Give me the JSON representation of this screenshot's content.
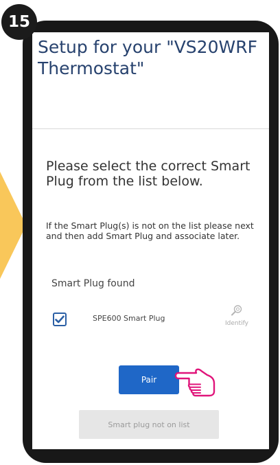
{
  "step": {
    "number": "15"
  },
  "screen": {
    "title": "Setup for your \"VS20WRF Thermostat\"",
    "prompt": "Please select the correct Smart Plug from the list below.",
    "help_text": "If the Smart Plug(s) is not on the list please next and then add Smart Plug and associate later.",
    "section_label": "Smart Plug found",
    "plug": {
      "name": "SPE600 Smart Plug",
      "checked": true,
      "identify_label": "Identify",
      "identify_icon": "magnifier-icon"
    },
    "pair_button": "Pair",
    "not_on_list_button": "Smart plug not on list"
  },
  "colors": {
    "title": "#27426e",
    "primary_button": "#1f67c7",
    "arrow": "#f9c75a",
    "hand": "#e0147a",
    "phone_frame": "#181818"
  }
}
